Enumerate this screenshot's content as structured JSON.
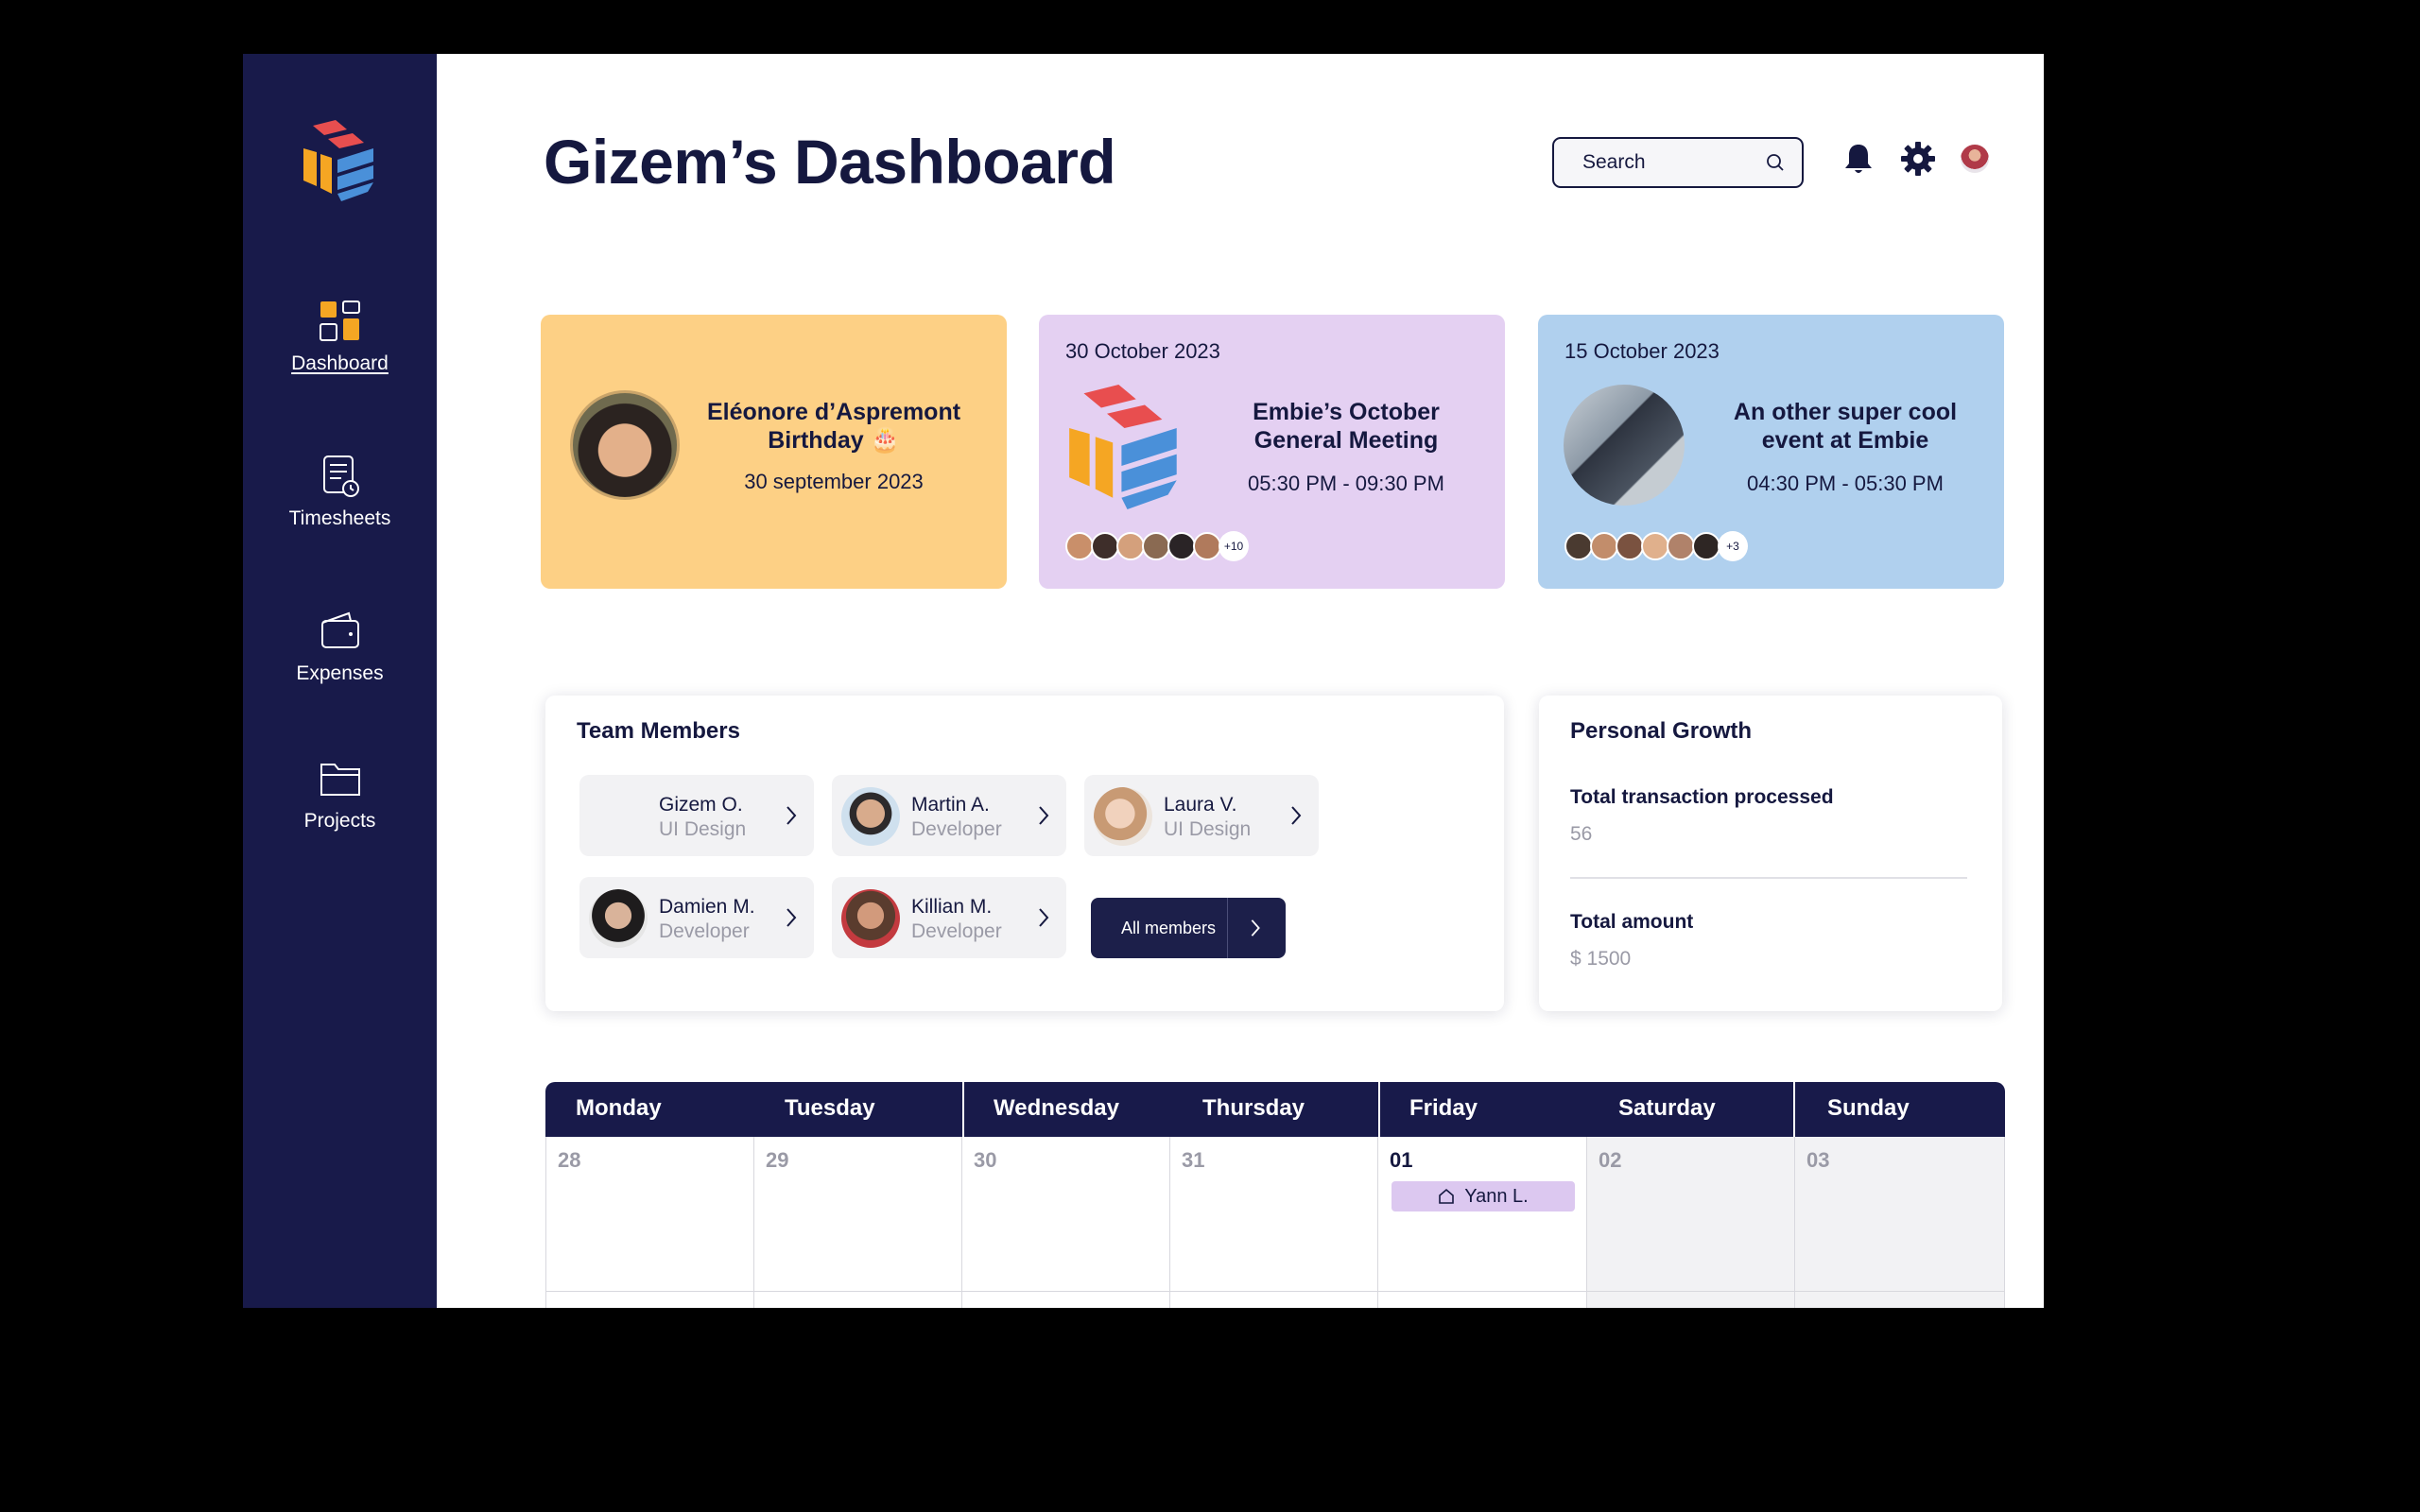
{
  "app": {
    "title": "Gizem’s Dashboard",
    "search_placeholder": "Search"
  },
  "sidebar": {
    "items": [
      {
        "label": "Dashboard",
        "icon": "dashboard-grid-icon",
        "active": true
      },
      {
        "label": "Timesheets",
        "icon": "timesheet-clock-icon"
      },
      {
        "label": "Expenses",
        "icon": "wallet-icon"
      },
      {
        "label": "Projects",
        "icon": "folder-icon"
      }
    ]
  },
  "cards": {
    "birthday": {
      "title": "Eléonore d’Aspremont Birthday 🎂",
      "date": "30 september 2023",
      "color": "#fdd085"
    },
    "meeting": {
      "date": "30 October 2023",
      "title": "Embie’s October General Meeting",
      "time": "05:30 PM - 09:30 PM",
      "more": "+10",
      "color": "#e4d0f2"
    },
    "event": {
      "date": "15 October 2023",
      "title": "An other super cool event at Embie",
      "time": "04:30 PM - 05:30 PM",
      "more": "+3",
      "color": "#b0d0ee"
    }
  },
  "team": {
    "title": "Team Members",
    "members": [
      {
        "name": "Gizem O.",
        "role": "UI Design"
      },
      {
        "name": "Martin A.",
        "role": "Developer"
      },
      {
        "name": "Laura V.",
        "role": "UI Design"
      },
      {
        "name": "Damien M.",
        "role": "Developer"
      },
      {
        "name": "Killian M.",
        "role": "Developer"
      }
    ],
    "all_label": "All members"
  },
  "growth": {
    "title": "Personal Growth",
    "metric1_label": "Total transaction processed",
    "metric1_value": "56",
    "metric2_label": "Total amount",
    "metric2_value": "$ 1500"
  },
  "calendar": {
    "days": [
      "Monday",
      "Tuesday",
      "Wednesday",
      "Thursday",
      "Friday",
      "Saturday",
      "Sunday"
    ],
    "dates": [
      "28",
      "29",
      "30",
      "31",
      "01",
      "02",
      "03"
    ],
    "event_label": "Yann L.",
    "colors": {
      "header": "#181a4a",
      "event": "#dcc8f0"
    }
  },
  "theme": {
    "sidebar": "#181a4a",
    "ink": "#15183f",
    "logo_red": "#e84e4f",
    "logo_orange": "#f5a623",
    "logo_blue": "#4a90d9"
  }
}
